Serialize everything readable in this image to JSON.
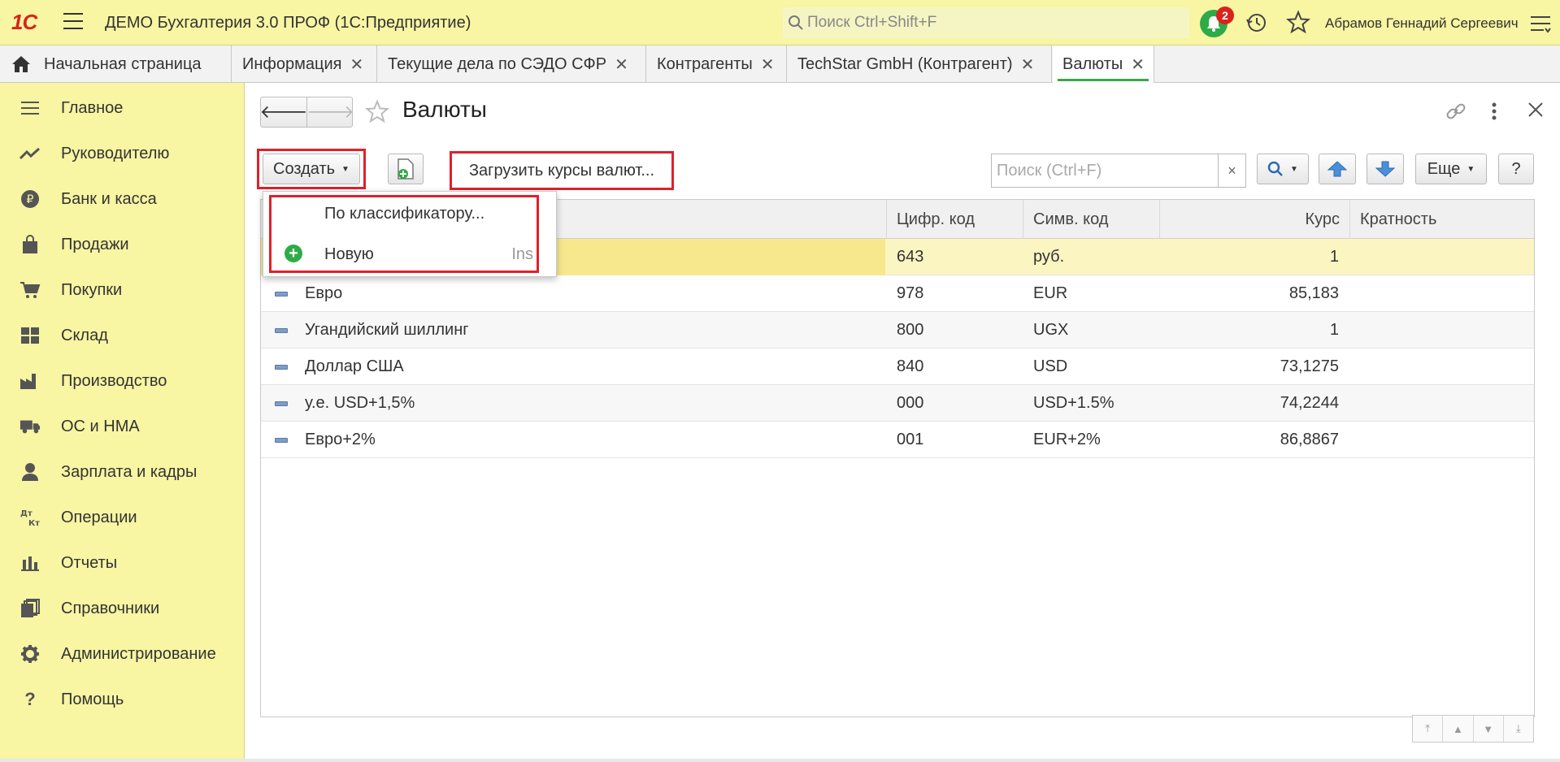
{
  "app": {
    "logo": "1С",
    "title": "ДЕМО Бухгалтерия 3.0 ПРОФ  (1С:Предприятие)",
    "search_placeholder": "Поиск Ctrl+Shift+F",
    "notifications_count": "2",
    "user": "Абрамов Геннадий Сергеевич"
  },
  "tabs": [
    {
      "label": "Начальная страница"
    },
    {
      "label": "Информация",
      "close": "✕"
    },
    {
      "label": "Текущие дела по СЭДО СФР",
      "close": "✕"
    },
    {
      "label": "Контрагенты",
      "close": "✕"
    },
    {
      "label": "TechStar GmbH (Контрагент)",
      "close": "✕"
    },
    {
      "label": "Валюты",
      "close": "✕"
    }
  ],
  "sidebar": {
    "items": [
      {
        "label": "Главное",
        "icon": "menu-lines-icon"
      },
      {
        "label": "Руководителю",
        "icon": "trend-icon"
      },
      {
        "label": "Банк и касса",
        "icon": "ruble-coin-icon"
      },
      {
        "label": "Продажи",
        "icon": "shopping-bag-icon"
      },
      {
        "label": "Покупки",
        "icon": "cart-icon"
      },
      {
        "label": "Склад",
        "icon": "warehouse-grid-icon"
      },
      {
        "label": "Производство",
        "icon": "factory-icon"
      },
      {
        "label": "ОС и НМА",
        "icon": "truck-icon"
      },
      {
        "label": "Зарплата и кадры",
        "icon": "person-icon"
      },
      {
        "label": "Операции",
        "icon": "dt-kt-icon"
      },
      {
        "label": "Отчеты",
        "icon": "bar-chart-icon"
      },
      {
        "label": "Справочники",
        "icon": "books-icon"
      },
      {
        "label": "Администрирование",
        "icon": "gear-icon"
      },
      {
        "label": "Помощь",
        "icon": "question-icon"
      }
    ]
  },
  "form": {
    "title": "Валюты",
    "create_label": "Создать",
    "load_rates_label": "Загрузить курсы валют...",
    "search_placeholder": "Поиск (Ctrl+F)",
    "search_clear": "×",
    "more_label": "Еще",
    "help_label": "?"
  },
  "dropdown": {
    "items": [
      {
        "label": "По классификатору..."
      },
      {
        "label": "Новую",
        "shortcut": "Ins"
      }
    ]
  },
  "table": {
    "columns": [
      "Цифр. код",
      "Симв. код",
      "Курс",
      "Кратность"
    ],
    "rows": [
      {
        "name": "",
        "num": "643",
        "sym": "руб.",
        "rate": "1",
        "mult": ""
      },
      {
        "name": "Евро",
        "num": "978",
        "sym": "EUR",
        "rate": "85,183",
        "mult": ""
      },
      {
        "name": "Угандийский шиллинг",
        "num": "800",
        "sym": "UGX",
        "rate": "1",
        "mult": ""
      },
      {
        "name": "Доллар США",
        "num": "840",
        "sym": "USD",
        "rate": "73,1275",
        "mult": ""
      },
      {
        "name": "у.е. USD+1,5%",
        "num": "000",
        "sym": "USD+1.5%",
        "rate": "74,2244",
        "mult": ""
      },
      {
        "name": "Евро+2%",
        "num": "001",
        "sym": "EUR+2%",
        "rate": "86,8867",
        "mult": ""
      }
    ]
  },
  "colors": {
    "panel_yellow": "#f8f5a3",
    "accent_green": "#2eab46",
    "highlight_red": "#e0202b",
    "selected_row": "#fbf5c2"
  }
}
